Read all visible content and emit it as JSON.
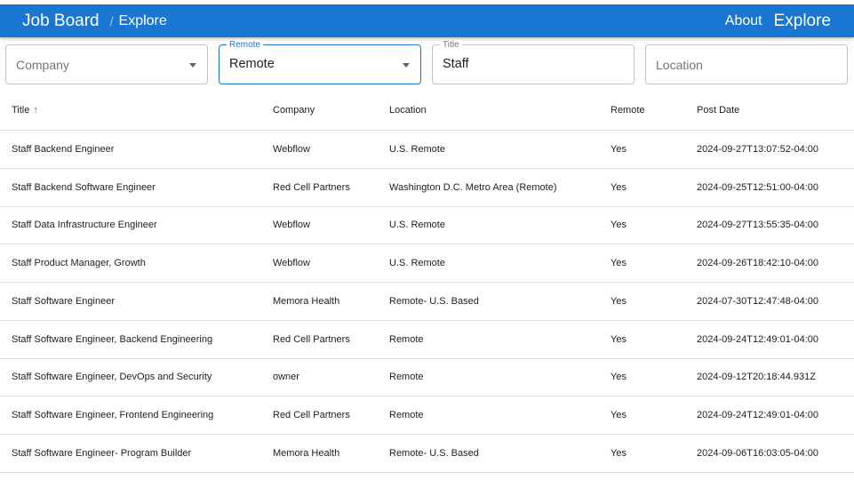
{
  "appbar": {
    "brand": "Job Board",
    "separator": "/",
    "crumb": "Explore",
    "nav_about": "About",
    "nav_explore": "Explore",
    "color": "#1976d2"
  },
  "filters": {
    "company": {
      "placeholder": "Company",
      "value": ""
    },
    "remote": {
      "label": "Remote",
      "value": "Remote"
    },
    "title": {
      "label": "Title",
      "value": "Staff"
    },
    "location": {
      "placeholder": "Location",
      "value": ""
    }
  },
  "table": {
    "headers": {
      "title": "Title",
      "company": "Company",
      "location": "Location",
      "remote": "Remote",
      "post_date": "Post Date"
    },
    "sort_icon": "arrow-upward-icon",
    "rows": [
      {
        "title": "Staff Backend Engineer",
        "company": "Webflow",
        "location": "U.S. Remote",
        "remote": "Yes",
        "post_date": "2024-09-27T13:07:52-04:00"
      },
      {
        "title": "Staff Backend Software Engineer",
        "company": "Red Cell Partners",
        "location": "Washington D.C. Metro Area (Remote)",
        "remote": "Yes",
        "post_date": "2024-09-25T12:51:00-04:00"
      },
      {
        "title": "Staff Data Infrastructure Engineer",
        "company": "Webflow",
        "location": "U.S. Remote",
        "remote": "Yes",
        "post_date": "2024-09-27T13:55:35-04:00"
      },
      {
        "title": "Staff Product Manager, Growth",
        "company": "Webflow",
        "location": "U.S. Remote",
        "remote": "Yes",
        "post_date": "2024-09-26T18:42:10-04:00"
      },
      {
        "title": "Staff Software Engineer",
        "company": "Memora Health",
        "location": "Remote- U.S. Based",
        "remote": "Yes",
        "post_date": "2024-07-30T12:47:48-04:00"
      },
      {
        "title": "Staff Software Engineer, Backend Engineering",
        "company": "Red Cell Partners",
        "location": "Remote",
        "remote": "Yes",
        "post_date": "2024-09-24T12:49:01-04:00"
      },
      {
        "title": "Staff Software Engineer, DevOps and Security",
        "company": "owner",
        "location": "Remote",
        "remote": "Yes",
        "post_date": "2024-09-12T20:18:44.931Z"
      },
      {
        "title": "Staff Software Engineer, Frontend Engineering",
        "company": "Red Cell Partners",
        "location": "Remote",
        "remote": "Yes",
        "post_date": "2024-09-24T12:49:01-04:00"
      },
      {
        "title": "Staff Software Engineer- Program Builder",
        "company": "Memora Health",
        "location": "Remote- U.S. Based",
        "remote": "Yes",
        "post_date": "2024-09-06T16:03:05-04:00"
      }
    ]
  }
}
